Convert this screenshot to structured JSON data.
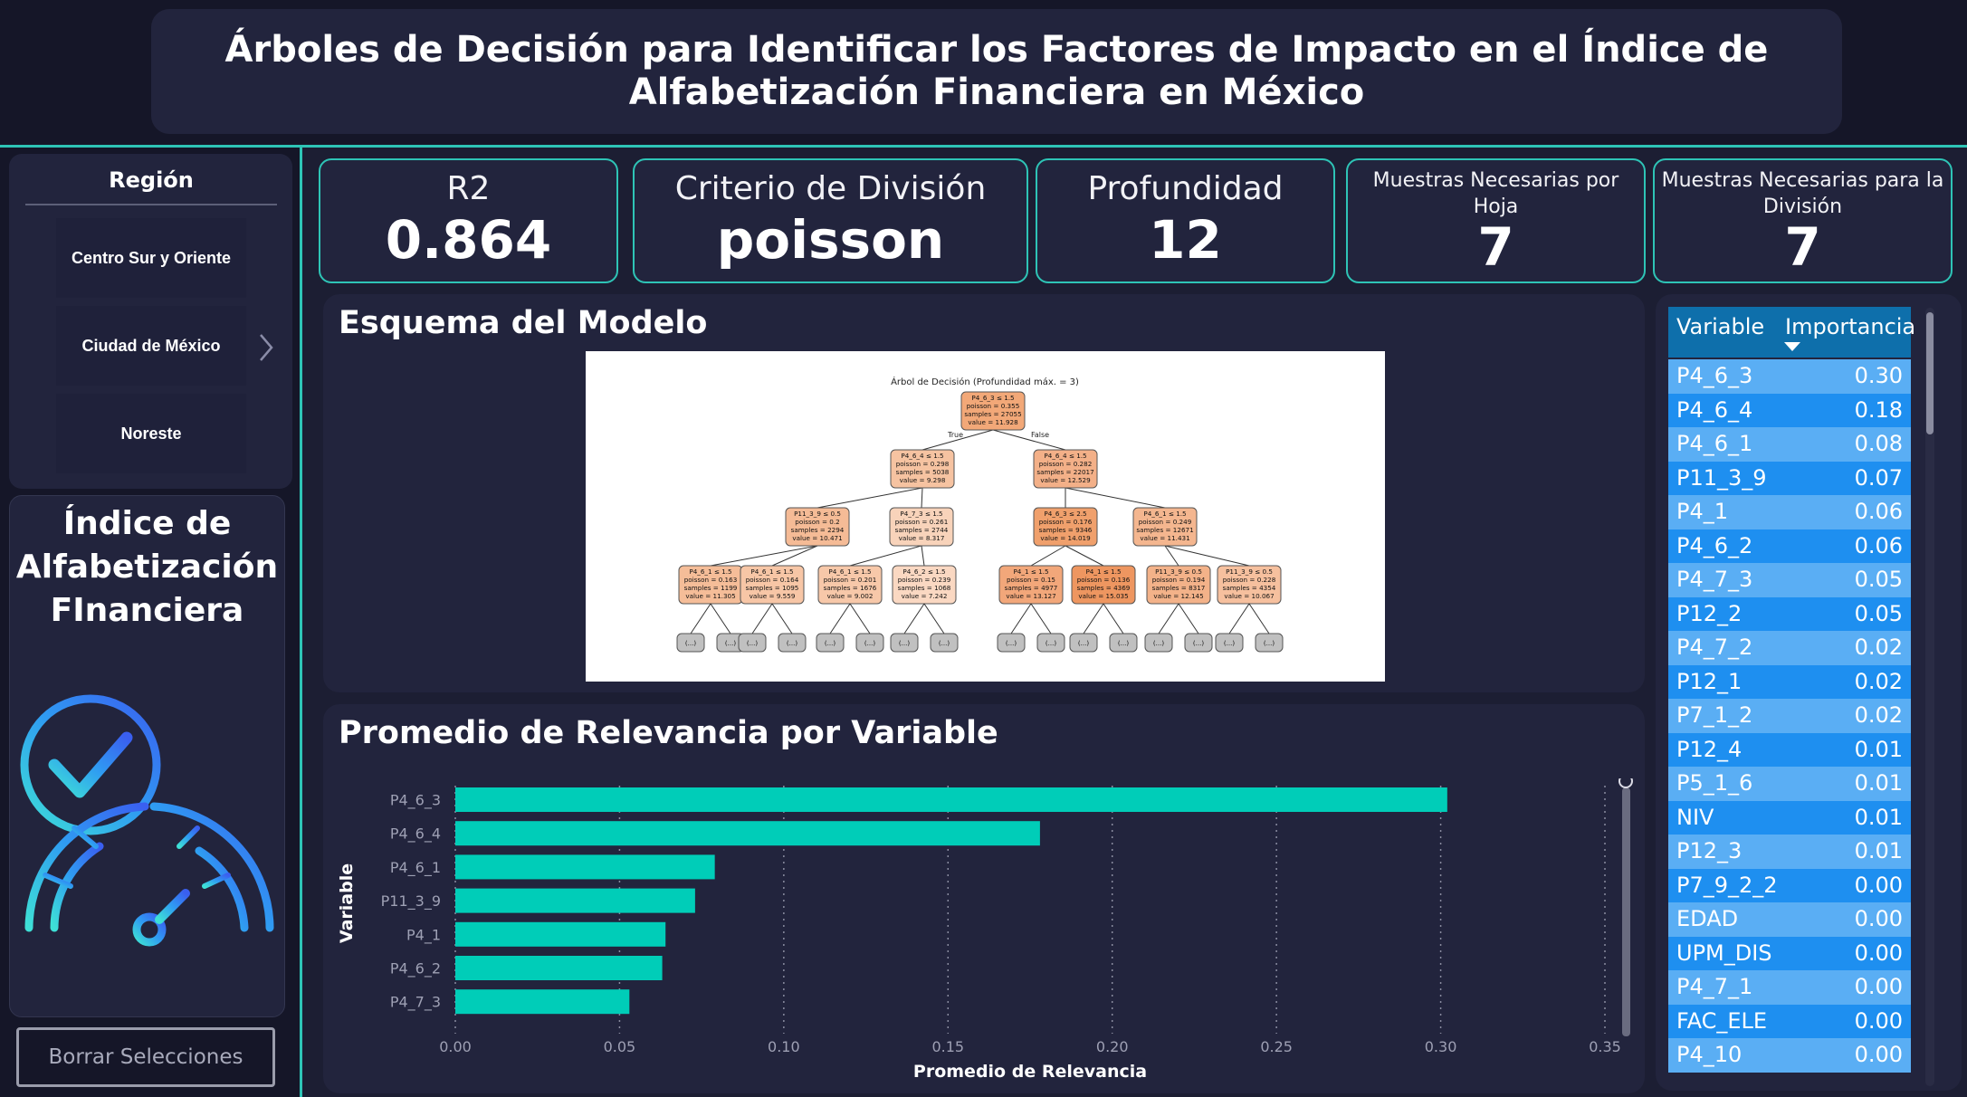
{
  "header": {
    "title": "Árboles de Decisión para Identificar los Factores de Impacto en el Índice de Alfabetización Financiera en México"
  },
  "slicer": {
    "title": "Región",
    "items": [
      {
        "label": "Centro Sur y Oriente"
      },
      {
        "label": "Ciudad de México"
      },
      {
        "label": "Noreste"
      }
    ]
  },
  "kpi_image": {
    "title": "Índice de Alfabetización FInanciera"
  },
  "clear_button": {
    "label": "Borrar Selecciones"
  },
  "cards": [
    {
      "label": "R2",
      "value": "0.864"
    },
    {
      "label": "Criterio de División",
      "value": "poisson"
    },
    {
      "label": "Profundidad",
      "value": "12"
    },
    {
      "label": "Muestras Necesarias por Hoja",
      "value": "7"
    },
    {
      "label": "Muestras Necesarias para la División",
      "value": "7"
    }
  ],
  "schema": {
    "title": "Esquema del Modelo",
    "tree_title": "Árbol de Decisión (Profundidad máx. = 3)",
    "edge_true": "True",
    "edge_false": "False",
    "truncated_label": "(...)",
    "nodes": [
      {
        "lines": [
          "P4_6_3 ≤ 1.5",
          "poisson = 0.355",
          "samples = 27055",
          "value = 11.928"
        ]
      },
      {
        "lines": [
          "P4_6_4 ≤ 1.5",
          "poisson = 0.298",
          "samples = 5038",
          "value = 9.298"
        ]
      },
      {
        "lines": [
          "P4_6_4 ≤ 1.5",
          "poisson = 0.282",
          "samples = 22017",
          "value = 12.529"
        ]
      },
      {
        "lines": [
          "P11_3_9 ≤ 0.5",
          "poisson = 0.2",
          "samples = 2294",
          "value = 10.471"
        ]
      },
      {
        "lines": [
          "P4_7_3 ≤ 1.5",
          "poisson = 0.261",
          "samples = 2744",
          "value = 8.317"
        ]
      },
      {
        "lines": [
          "P4_6_3 ≤ 2.5",
          "poisson = 0.176",
          "samples = 9346",
          "value = 14.019"
        ]
      },
      {
        "lines": [
          "P4_6_1 ≤ 1.5",
          "poisson = 0.249",
          "samples = 12671",
          "value = 11.431"
        ]
      },
      {
        "lines": [
          "P4_6_1 ≤ 1.5",
          "poisson = 0.163",
          "samples = 1199",
          "value = 11.305"
        ]
      },
      {
        "lines": [
          "P4_6_1 ≤ 1.5",
          "poisson = 0.164",
          "samples = 1095",
          "value = 9.559"
        ]
      },
      {
        "lines": [
          "P4_6_1 ≤ 1.5",
          "poisson = 0.201",
          "samples = 1676",
          "value = 9.002"
        ]
      },
      {
        "lines": [
          "P4_6_2 ≤ 1.5",
          "poisson = 0.239",
          "samples = 1068",
          "value = 7.242"
        ]
      },
      {
        "lines": [
          "P4_1 ≤ 1.5",
          "poisson = 0.15",
          "samples = 4977",
          "value = 13.127"
        ]
      },
      {
        "lines": [
          "P4_1 ≤ 1.5",
          "poisson = 0.136",
          "samples = 4369",
          "value = 15.035"
        ]
      },
      {
        "lines": [
          "P11_3_9 ≤ 0.5",
          "poisson = 0.194",
          "samples = 8317",
          "value = 12.145"
        ]
      },
      {
        "lines": [
          "P11_3_9 ≤ 0.5",
          "poisson = 0.228",
          "samples = 4354",
          "value = 10.067"
        ]
      }
    ]
  },
  "importance_table": {
    "col_variable": "Variable",
    "col_importance": "Importancia",
    "rows": [
      {
        "variable": "P4_6_3",
        "importancia": "0.30"
      },
      {
        "variable": "P4_6_4",
        "importancia": "0.18"
      },
      {
        "variable": "P4_6_1",
        "importancia": "0.08"
      },
      {
        "variable": "P11_3_9",
        "importancia": "0.07"
      },
      {
        "variable": "P4_1",
        "importancia": "0.06"
      },
      {
        "variable": "P4_6_2",
        "importancia": "0.06"
      },
      {
        "variable": "P4_7_3",
        "importancia": "0.05"
      },
      {
        "variable": "P12_2",
        "importancia": "0.05"
      },
      {
        "variable": "P4_7_2",
        "importancia": "0.02"
      },
      {
        "variable": "P12_1",
        "importancia": "0.02"
      },
      {
        "variable": "P7_1_2",
        "importancia": "0.02"
      },
      {
        "variable": "P12_4",
        "importancia": "0.01"
      },
      {
        "variable": "P5_1_6",
        "importancia": "0.01"
      },
      {
        "variable": "NIV",
        "importancia": "0.01"
      },
      {
        "variable": "P12_3",
        "importancia": "0.01"
      },
      {
        "variable": "P7_9_2_2",
        "importancia": "0.00"
      },
      {
        "variable": "EDAD",
        "importancia": "0.00"
      },
      {
        "variable": "UPM_DIS",
        "importancia": "0.00"
      },
      {
        "variable": "P4_7_1",
        "importancia": "0.00"
      },
      {
        "variable": "FAC_ELE",
        "importancia": "0.00"
      },
      {
        "variable": "P4_10",
        "importancia": "0.00"
      }
    ]
  },
  "chart_data": {
    "type": "bar",
    "orientation": "horizontal",
    "title": "Promedio de Relevancia por Variable",
    "xlabel": "Promedio de Relevancia",
    "ylabel": "Variable",
    "categories": [
      "P4_6_3",
      "P4_6_4",
      "P4_6_1",
      "P11_3_9",
      "P4_1",
      "P4_6_2",
      "P4_7_3"
    ],
    "values": [
      0.302,
      0.178,
      0.079,
      0.073,
      0.064,
      0.063,
      0.053
    ],
    "xlim": [
      0,
      0.35
    ],
    "xticks": [
      "0.00",
      "0.05",
      "0.10",
      "0.15",
      "0.20",
      "0.25",
      "0.30",
      "0.35"
    ],
    "grid": "vertical dotted",
    "bar_color": "#00cdb8"
  },
  "colors": {
    "accent": "#2ec4b6",
    "bar": "#00cdb8",
    "table_header": "#0e6fab",
    "row_dark": "#1e8ff0",
    "row_light": "#5aaef4",
    "node": "#f4b38c"
  }
}
